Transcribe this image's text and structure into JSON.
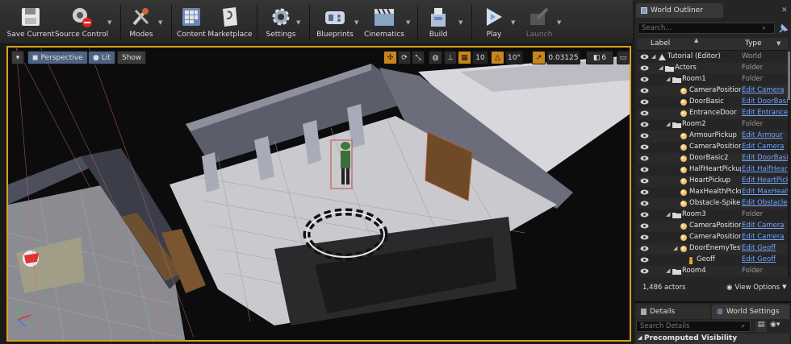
{
  "toolbar": {
    "buttons": [
      {
        "label": "Save Current",
        "icon": "save-icon"
      },
      {
        "label": "Source Control",
        "icon": "source-control-icon"
      },
      {
        "label": "Modes",
        "icon": "modes-icon"
      },
      {
        "label": "Content",
        "icon": "content-icon"
      },
      {
        "label": "Marketplace",
        "icon": "marketplace-icon"
      },
      {
        "label": "Settings",
        "icon": "settings-icon"
      },
      {
        "label": "Blueprints",
        "icon": "blueprints-icon"
      },
      {
        "label": "Cinematics",
        "icon": "cinematics-icon"
      },
      {
        "label": "Build",
        "icon": "build-icon"
      },
      {
        "label": "Play",
        "icon": "play-icon"
      },
      {
        "label": "Launch",
        "icon": "launch-icon",
        "disabled": true
      }
    ]
  },
  "viewport": {
    "perspective_label": "Perspective",
    "lit_label": "Lit",
    "show_label": "Show",
    "grid_snap": "10",
    "rotation_snap": "10°",
    "scale_snap": "0.03125",
    "camera_speed": "6",
    "accent_color": "#d6a21f"
  },
  "outliner": {
    "tab_label": "World Outliner",
    "search_placeholder": "Search...",
    "col_label": "Label",
    "col_type": "Type",
    "rows": [
      {
        "label": "Tutorial (Editor)",
        "type": "World",
        "indent": 0,
        "kind": "world",
        "expand": true,
        "link": false
      },
      {
        "label": "Actors",
        "type": "Folder",
        "indent": 1,
        "kind": "folder",
        "expand": true,
        "link": false
      },
      {
        "label": "Room1",
        "type": "Folder",
        "indent": 2,
        "kind": "folder",
        "expand": true,
        "link": false
      },
      {
        "label": "CameraPosition",
        "type": "Edit Camera",
        "indent": 3,
        "kind": "actor",
        "expand": false,
        "link": true
      },
      {
        "label": "DoorBasic",
        "type": "Edit DoorBasic",
        "indent": 3,
        "kind": "actor",
        "expand": false,
        "link": true
      },
      {
        "label": "EntranceDoor",
        "type": "Edit Entrance",
        "indent": 3,
        "kind": "actor",
        "expand": false,
        "link": true
      },
      {
        "label": "Room2",
        "type": "Folder",
        "indent": 2,
        "kind": "folder",
        "expand": true,
        "link": false
      },
      {
        "label": "ArmourPickup",
        "type": "Edit Armour",
        "indent": 3,
        "kind": "actor",
        "expand": false,
        "link": true
      },
      {
        "label": "CameraPosition",
        "type": "Edit Camera",
        "indent": 3,
        "kind": "actor",
        "expand": false,
        "link": true
      },
      {
        "label": "DoorBasic2",
        "type": "Edit DoorBasic",
        "indent": 3,
        "kind": "actor",
        "expand": false,
        "link": true
      },
      {
        "label": "HalfHeartPickup",
        "type": "Edit HalfHeart",
        "indent": 3,
        "kind": "actor",
        "expand": false,
        "link": true
      },
      {
        "label": "HeartPickup",
        "type": "Edit HeartPickup",
        "indent": 3,
        "kind": "actor",
        "expand": false,
        "link": true
      },
      {
        "label": "MaxHealthPickup",
        "type": "Edit MaxHealth",
        "indent": 3,
        "kind": "actor",
        "expand": false,
        "link": true
      },
      {
        "label": "Obstacle-Spike",
        "type": "Edit Obstacle",
        "indent": 3,
        "kind": "actor",
        "expand": false,
        "link": true
      },
      {
        "label": "Room3",
        "type": "Folder",
        "indent": 2,
        "kind": "folder",
        "expand": true,
        "link": false
      },
      {
        "label": "CameraPosition",
        "type": "Edit Camera",
        "indent": 3,
        "kind": "actor",
        "expand": false,
        "link": true
      },
      {
        "label": "CameraPosition",
        "type": "Edit Camera",
        "indent": 3,
        "kind": "actor",
        "expand": false,
        "link": true
      },
      {
        "label": "DoorEnemyTest",
        "type": "Edit Geoff",
        "indent": 3,
        "kind": "actor",
        "expand": true,
        "link": true
      },
      {
        "label": "Geoff",
        "type": "Edit Geoff",
        "indent": 4,
        "kind": "pawn",
        "expand": false,
        "link": true
      },
      {
        "label": "Room4",
        "type": "Folder",
        "indent": 2,
        "kind": "folder",
        "expand": true,
        "link": false
      }
    ],
    "actor_count": "1,486 actors",
    "view_options_label": "View Options"
  },
  "details": {
    "tab_details": "Details",
    "tab_world_settings": "World Settings",
    "search_placeholder": "Search Details",
    "section_title": "Precomputed Visibility"
  }
}
